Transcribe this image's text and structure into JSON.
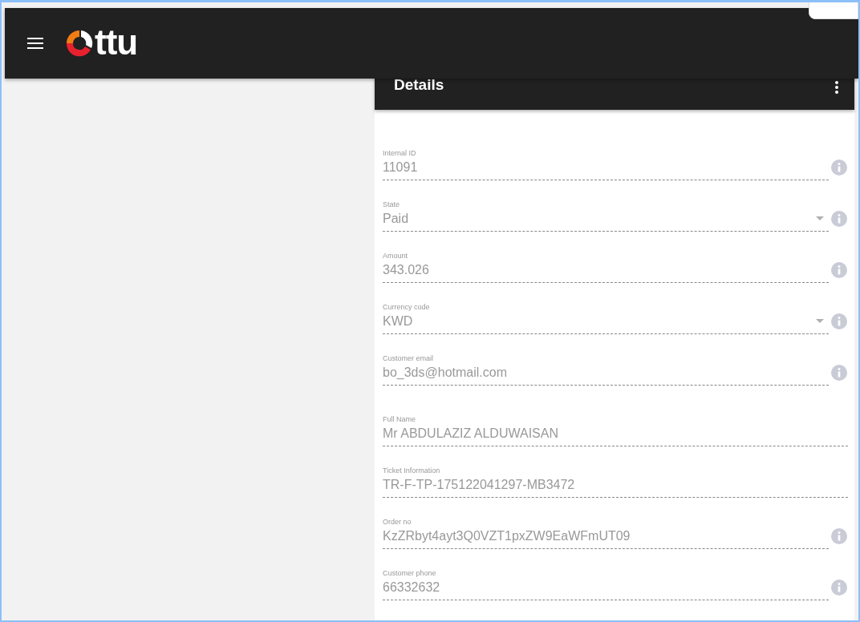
{
  "app_bar": {
    "logo_text": "ttu"
  },
  "details": {
    "title": "Details",
    "fields": [
      {
        "label": "Internal ID",
        "value": "11091",
        "kind": "text",
        "info": true
      },
      {
        "label": "State",
        "value": "Paid",
        "kind": "select",
        "info": true
      },
      {
        "label": "Amount",
        "value": "343.026",
        "kind": "text",
        "info": true
      },
      {
        "label": "Currency code",
        "value": "KWD",
        "kind": "select",
        "info": true
      },
      {
        "label": "Customer email",
        "value": "bo_3ds@hotmail.com",
        "kind": "text",
        "info": true
      },
      {
        "label": "Full Name",
        "value": "Mr ABDULAZIZ ALDUWAISAN",
        "kind": "text",
        "info": false
      },
      {
        "label": "Ticket Information",
        "value": "TR-F-TP-175122041297-MB3472",
        "kind": "text",
        "info": false
      },
      {
        "label": "Order no",
        "value": "KzZRbyt4ayt3Q0VZT1pxZW9EaWFmUT09",
        "kind": "text",
        "info": true
      },
      {
        "label": "Customer phone",
        "value": "66332632",
        "kind": "text",
        "info": true
      }
    ]
  }
}
